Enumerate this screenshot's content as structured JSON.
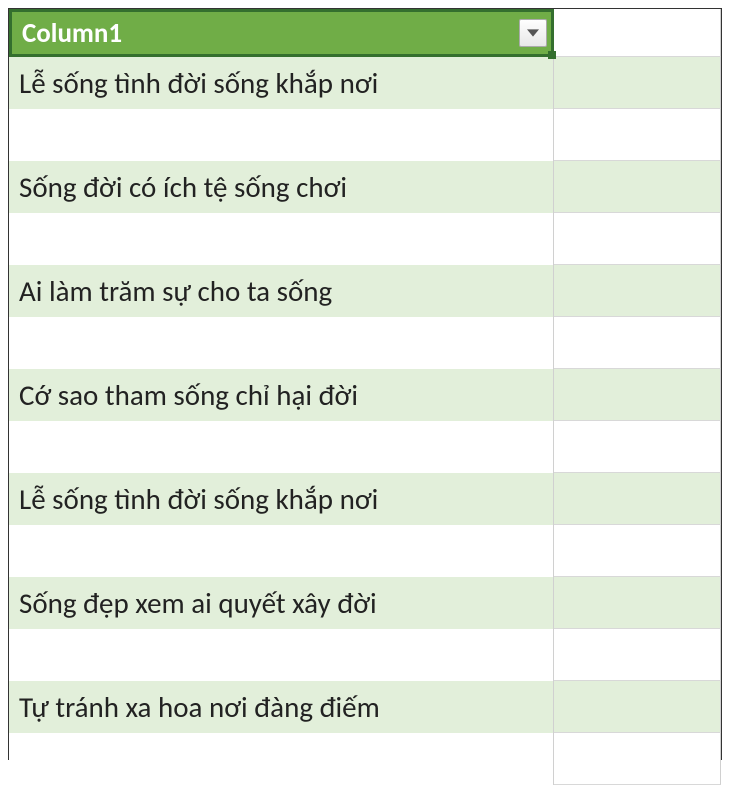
{
  "table": {
    "header": "Column1",
    "rows": [
      "Lễ sống tình đời sống khắp nơi",
      "",
      "Sống đời có ích tệ sống chơi",
      "",
      "Ai làm trăm sự cho ta sống",
      "",
      "Cớ sao tham sống chỉ hại đời",
      "",
      "Lễ sống tình đời sống khắp nơi",
      "",
      "Sống đẹp xem ai quyết xây đời",
      "",
      "Tự tránh xa hoa nơi đàng điếm",
      ""
    ]
  },
  "colors": {
    "header_bg": "#70AD47",
    "header_border": "#346f2e",
    "band_light": "#e2efda"
  }
}
